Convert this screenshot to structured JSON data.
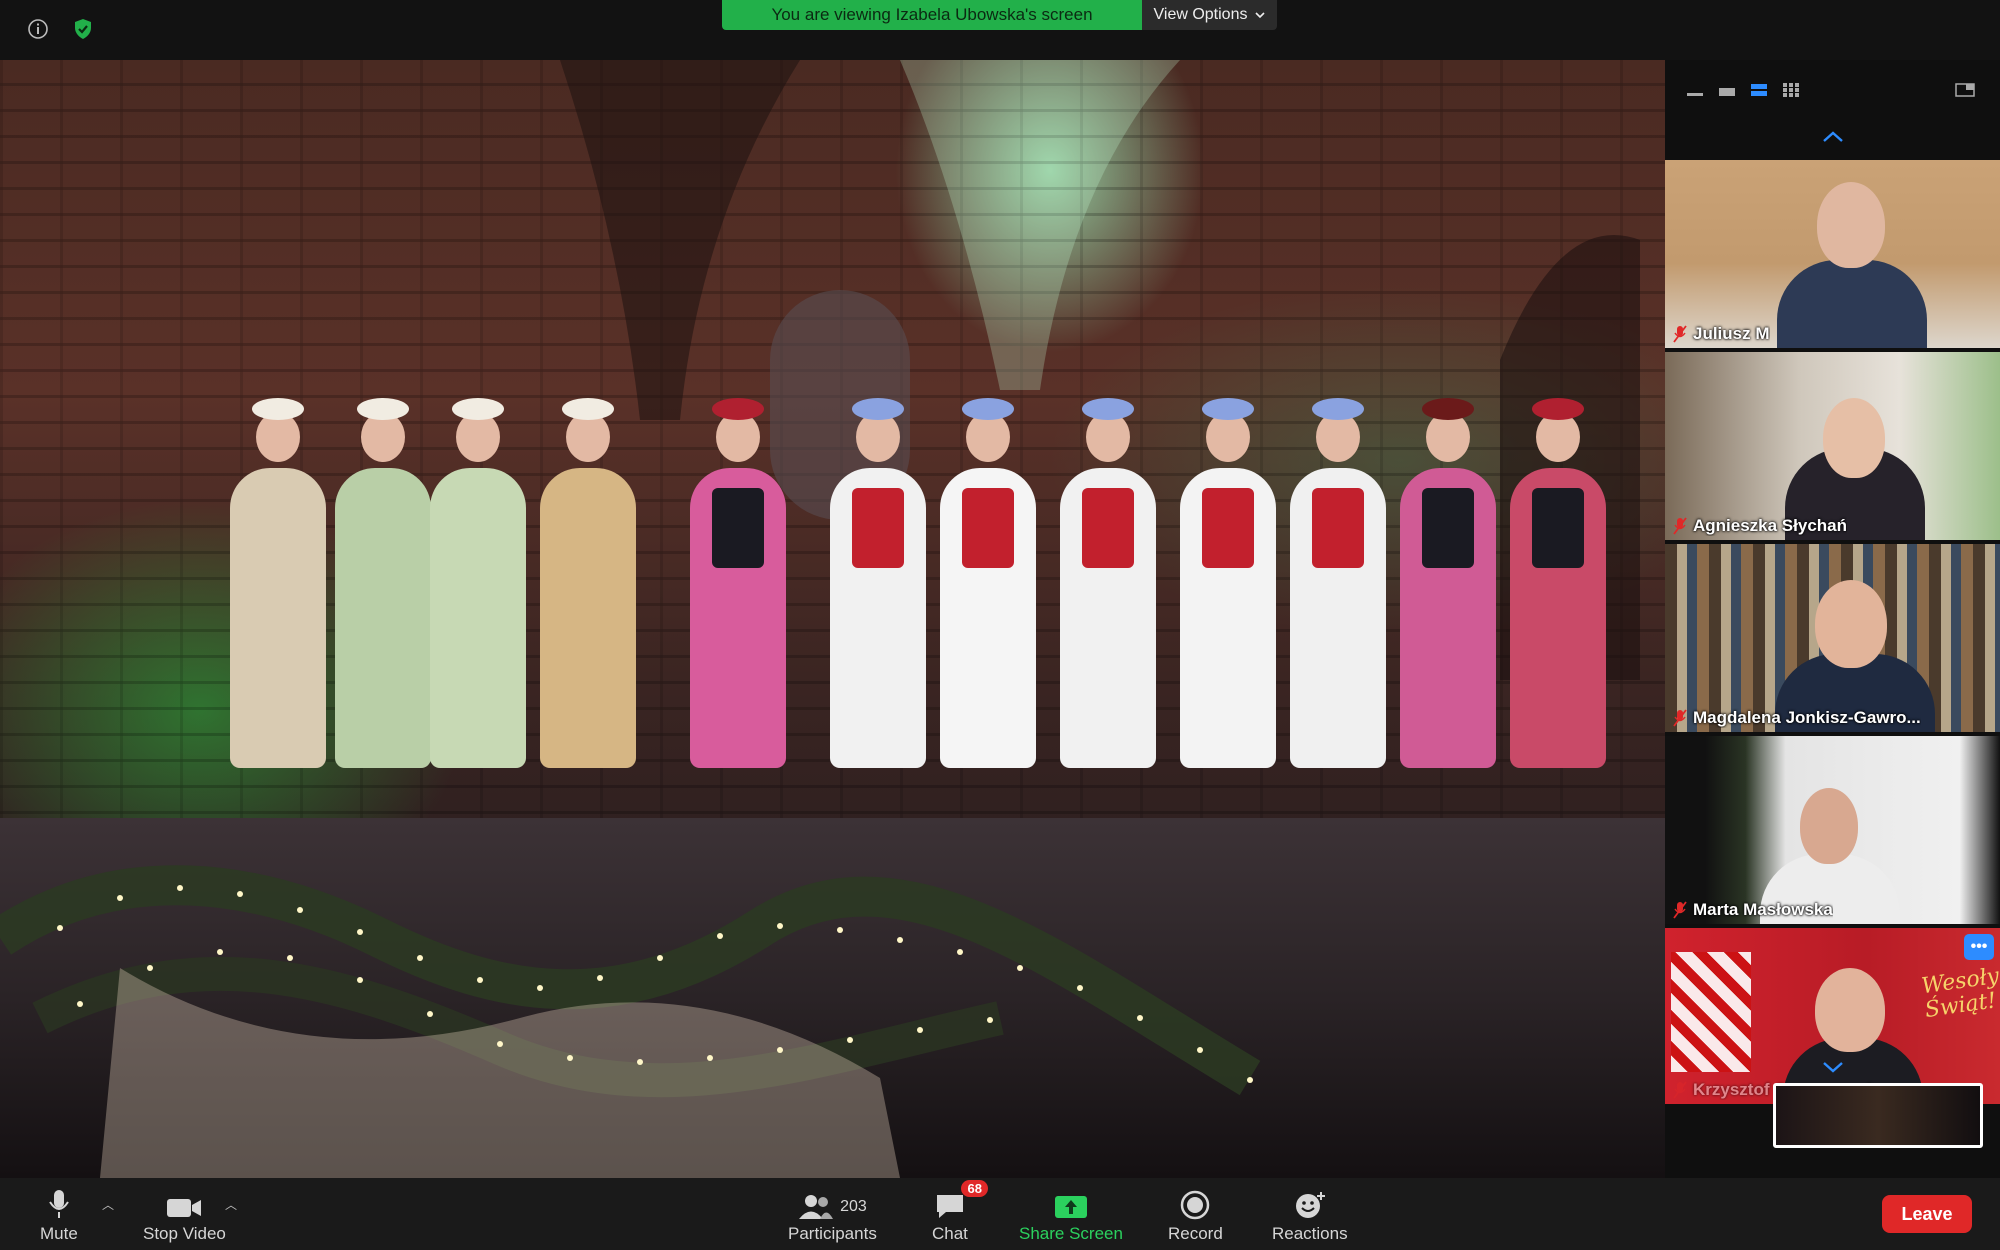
{
  "top_bar": {
    "banner_text": "You are viewing Izabela Ubowska's screen",
    "view_options_label": "View Options",
    "banner_color": "#22b04a"
  },
  "participants_panel": {
    "tiles": [
      {
        "name": "Juliusz M",
        "muted": true
      },
      {
        "name": "Agnieszka Słychań",
        "muted": true
      },
      {
        "name": "Magdalena Jonkisz-Gawro...",
        "muted": true
      },
      {
        "name": "Marta Masłowska",
        "muted": true
      },
      {
        "name": "Krzysztof Grzegorczyk",
        "muted": true,
        "background_text": "Wesołych Świąt!"
      }
    ],
    "more_label": "•••"
  },
  "toolbar": {
    "mute_label": "Mute",
    "stop_video_label": "Stop Video",
    "participants_label": "Participants",
    "participants_count": "203",
    "chat_label": "Chat",
    "chat_badge": "68",
    "share_screen_label": "Share Screen",
    "record_label": "Record",
    "reactions_label": "Reactions",
    "leave_label": "Leave",
    "accent_color": "#2bd15e",
    "leave_color": "#e02828"
  },
  "icons": [
    "info-icon",
    "shield-check-icon",
    "chevron-down-icon",
    "speaker-view-icon",
    "gallery-view-icon",
    "microphone-icon",
    "video-camera-icon",
    "participants-icon",
    "chat-bubble-icon",
    "share-screen-icon",
    "record-icon",
    "reactions-icon",
    "mic-muted-icon"
  ]
}
